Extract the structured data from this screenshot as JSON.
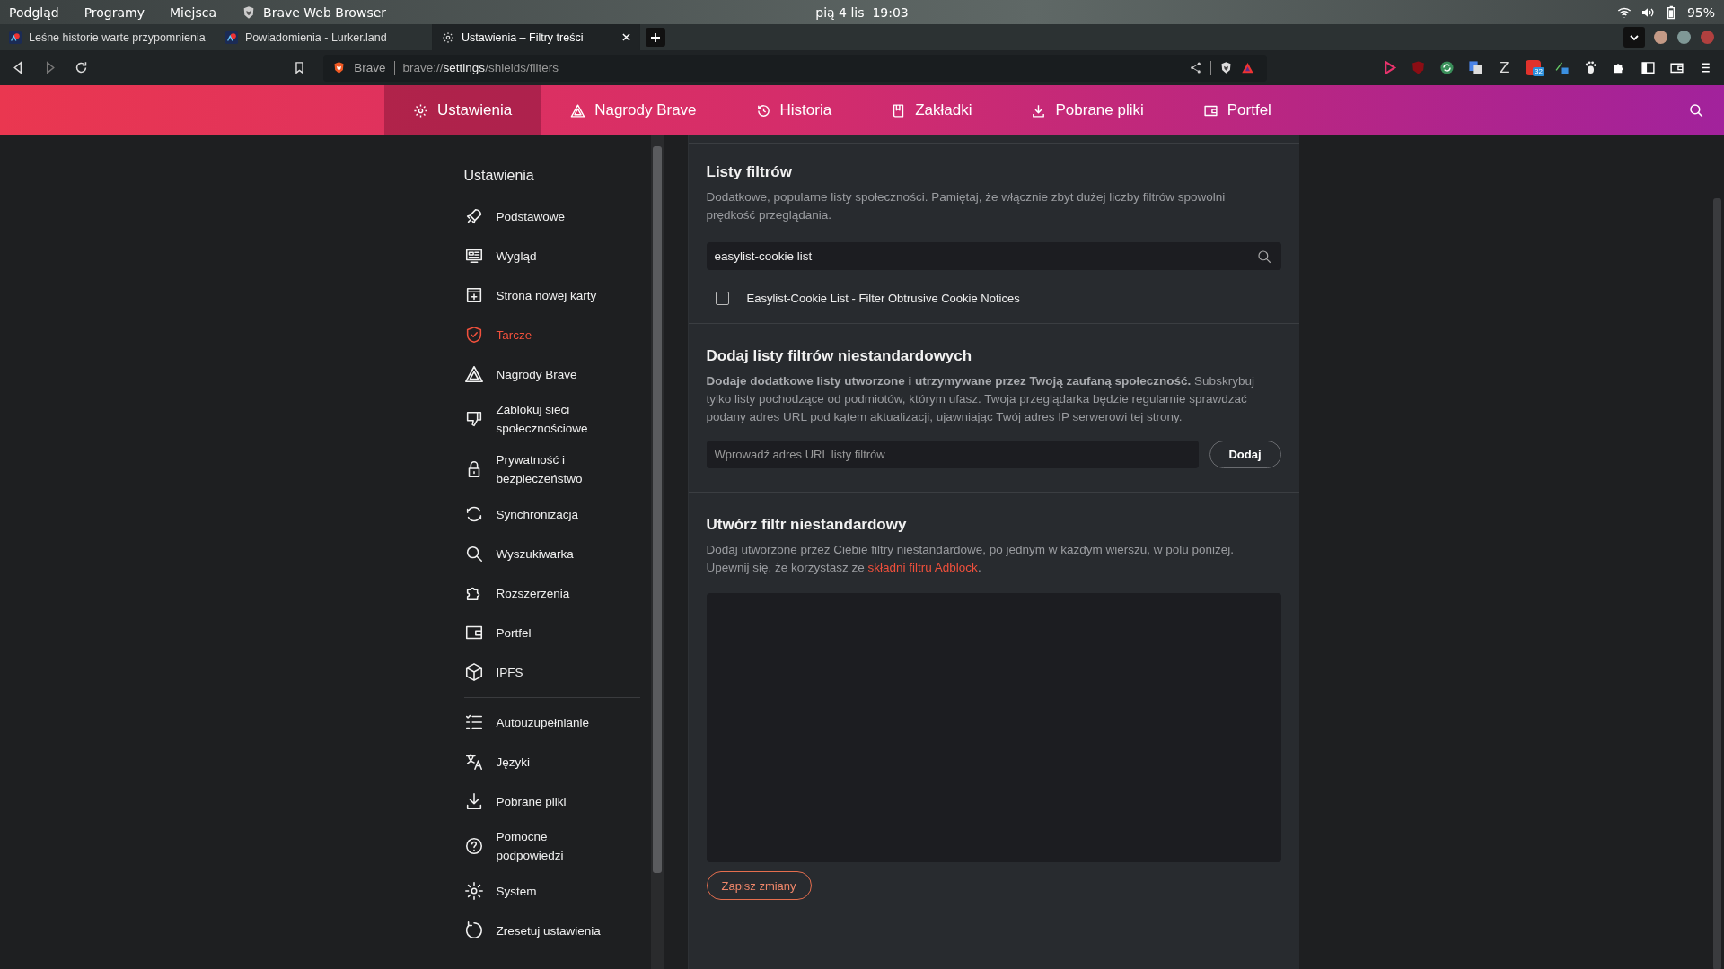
{
  "os_bar": {
    "menus": [
      "Podgląd",
      "Programy",
      "Miejsca"
    ],
    "app_name": "Brave Web Browser",
    "clock": "pią 4 lis  19:03",
    "battery": "95%"
  },
  "tabs": [
    {
      "title": "Leśne historie warte przypomnienia",
      "selected": false
    },
    {
      "title": "Powiadomienia - Lurker.land",
      "selected": false
    },
    {
      "title": "Ustawienia – Filtry treści",
      "selected": true
    }
  ],
  "toolbar": {
    "site_label": "Brave",
    "url_scheme": "brave://",
    "url_host": "settings",
    "url_path": "/shields/filters",
    "extension_letter": "Z",
    "extension_badge": "32"
  },
  "nav": [
    {
      "label": "Ustawienia",
      "selected": true
    },
    {
      "label": "Nagrody Brave",
      "selected": false
    },
    {
      "label": "Historia",
      "selected": false
    },
    {
      "label": "Zakładki",
      "selected": false
    },
    {
      "label": "Pobrane pliki",
      "selected": false
    },
    {
      "label": "Portfel",
      "selected": false
    }
  ],
  "sidebar": {
    "title": "Ustawienia",
    "groups": [
      {
        "items": [
          {
            "label": "Podstawowe",
            "selected": false
          },
          {
            "label": "Wygląd",
            "selected": false
          },
          {
            "label": "Strona nowej karty",
            "selected": false
          },
          {
            "label": "Tarcze",
            "selected": true
          },
          {
            "label": "Nagrody Brave",
            "selected": false
          },
          {
            "label": "Zablokuj sieci społecznościowe",
            "selected": false
          },
          {
            "label": "Prywatność i bezpieczeństwo",
            "selected": false
          },
          {
            "label": "Synchronizacja",
            "selected": false
          },
          {
            "label": "Wyszukiwarka",
            "selected": false
          },
          {
            "label": "Rozszerzenia",
            "selected": false
          },
          {
            "label": "Portfel",
            "selected": false
          },
          {
            "label": "IPFS",
            "selected": false
          }
        ]
      },
      {
        "items": [
          {
            "label": "Autouzupełnianie",
            "selected": false
          },
          {
            "label": "Języki",
            "selected": false
          },
          {
            "label": "Pobrane pliki",
            "selected": false
          },
          {
            "label": "Pomocne podpowiedzi",
            "selected": false
          },
          {
            "label": "System",
            "selected": false
          },
          {
            "label": "Zresetuj ustawienia",
            "selected": false
          }
        ]
      }
    ]
  },
  "content": {
    "filter_lists": {
      "title": "Listy filtrów",
      "description": "Dodatkowe, popularne listy społeczności. Pamiętaj, że włącznie zbyt dużej liczby filtrów spowolni prędkość przeglądania.",
      "search_value": "easylist-cookie list",
      "results": [
        {
          "label": "Easylist-Cookie List - Filter Obtrusive Cookie Notices",
          "checked": false
        }
      ]
    },
    "custom_lists": {
      "title": "Dodaj listy filtrów niestandardowych",
      "description": "**Dodaje dodatkowe listy utworzone i utrzymywane przez Twoją zaufaną społeczność.** Subskrybuj tylko listy pochodzące od podmiotów, którym ufasz. Twoja przeglądarka będzie regularnie sprawdzać podany adres URL pod kątem aktualizacji, ujawniając Twój adres IP serwerowi tej strony.",
      "url_placeholder": "Wprowadź adres URL listy filtrów",
      "add_button": "Dodaj"
    },
    "custom_filter": {
      "title": "Utwórz filtr niestandardowy",
      "description": "Dodaj utworzone przez Ciebie filtry niestandardowe, po jednym w każdym wierszu, w polu poniżej. Upewnij się, że korzystasz ze",
      "link": "składni filtru Adblock",
      "after_link": ".",
      "save_button": "Zapisz zmiany"
    }
  }
}
